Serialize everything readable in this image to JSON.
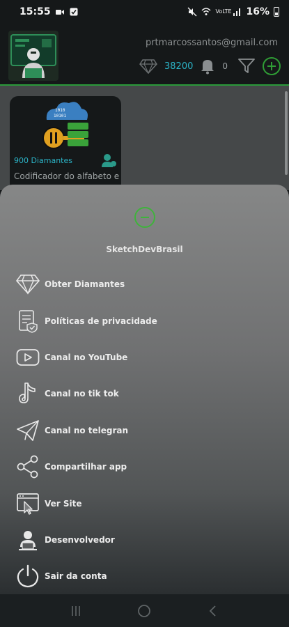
{
  "status_bar": {
    "time": "15:55",
    "battery": "16%",
    "network": "VoLTE"
  },
  "header": {
    "email": "prtmarcossantos@gmail.com",
    "diamonds": "38200",
    "notifications": "0"
  },
  "card": {
    "price": "900 Diamantes",
    "title": "Codificador do alfabeto e"
  },
  "drawer": {
    "title": "SketchDevBrasil",
    "items": [
      {
        "label": "Obter Diamantes",
        "icon": "diamond-icon"
      },
      {
        "label": "Políticas de privacidade",
        "icon": "privacy-document-icon"
      },
      {
        "label": "Canal no YouTube",
        "icon": "youtube-icon"
      },
      {
        "label": "Canal no tik tok",
        "icon": "tiktok-icon"
      },
      {
        "label": "Canal no telegran",
        "icon": "telegram-icon"
      },
      {
        "label": "Compartilhar app",
        "icon": "share-icon"
      },
      {
        "label": "Ver Site",
        "icon": "website-icon"
      },
      {
        "label": "Desenvolvedor",
        "icon": "developer-icon"
      },
      {
        "label": "Sair da conta",
        "icon": "power-icon"
      }
    ]
  },
  "colors": {
    "accent_green": "#2f9c35",
    "diamond_blue": "#2bb3c6"
  }
}
